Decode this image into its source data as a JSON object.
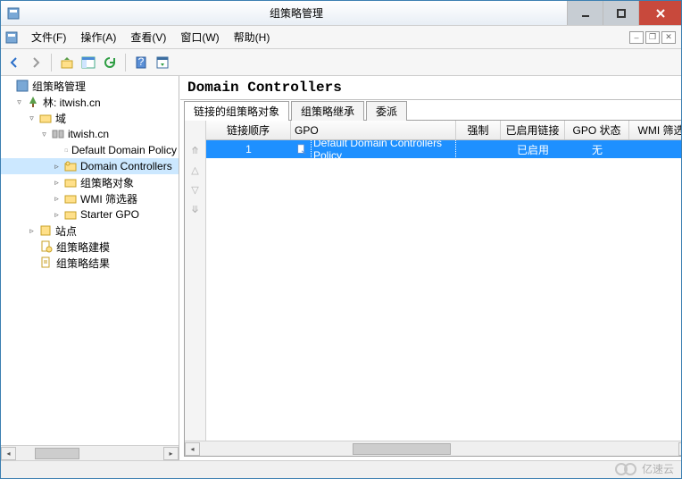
{
  "window": {
    "title": "组策略管理"
  },
  "menu": {
    "file": "文件(F)",
    "action": "操作(A)",
    "view": "查看(V)",
    "window": "窗口(W)",
    "help": "帮助(H)"
  },
  "tree": {
    "root": "组策略管理",
    "forest": "林: itwish.cn",
    "domains": "域",
    "domain": "itwish.cn",
    "default_domain": "Default Domain Policy",
    "domain_controllers": "Domain Controllers",
    "gpo_objects": "组策略对象",
    "wmi_filters": "WMI 筛选器",
    "starter_gpo": "Starter GPO",
    "sites": "站点",
    "modeling": "组策略建模",
    "results": "组策略结果"
  },
  "content": {
    "header": "Domain Controllers",
    "tabs": {
      "linked": "链接的组策略对象",
      "inherit": "组策略继承",
      "deleg": "委派"
    },
    "columns": {
      "order": "链接顺序",
      "gpo": "GPO",
      "force": "强制",
      "link": "已启用链接",
      "status": "GPO 状态",
      "wmi": "WMI 筛选"
    },
    "rows": [
      {
        "order": "1",
        "gpo": "Default Domain Controllers Policy",
        "force": "",
        "link": "已启用",
        "status": "无",
        "wmi": ""
      }
    ]
  },
  "watermark": "亿速云"
}
